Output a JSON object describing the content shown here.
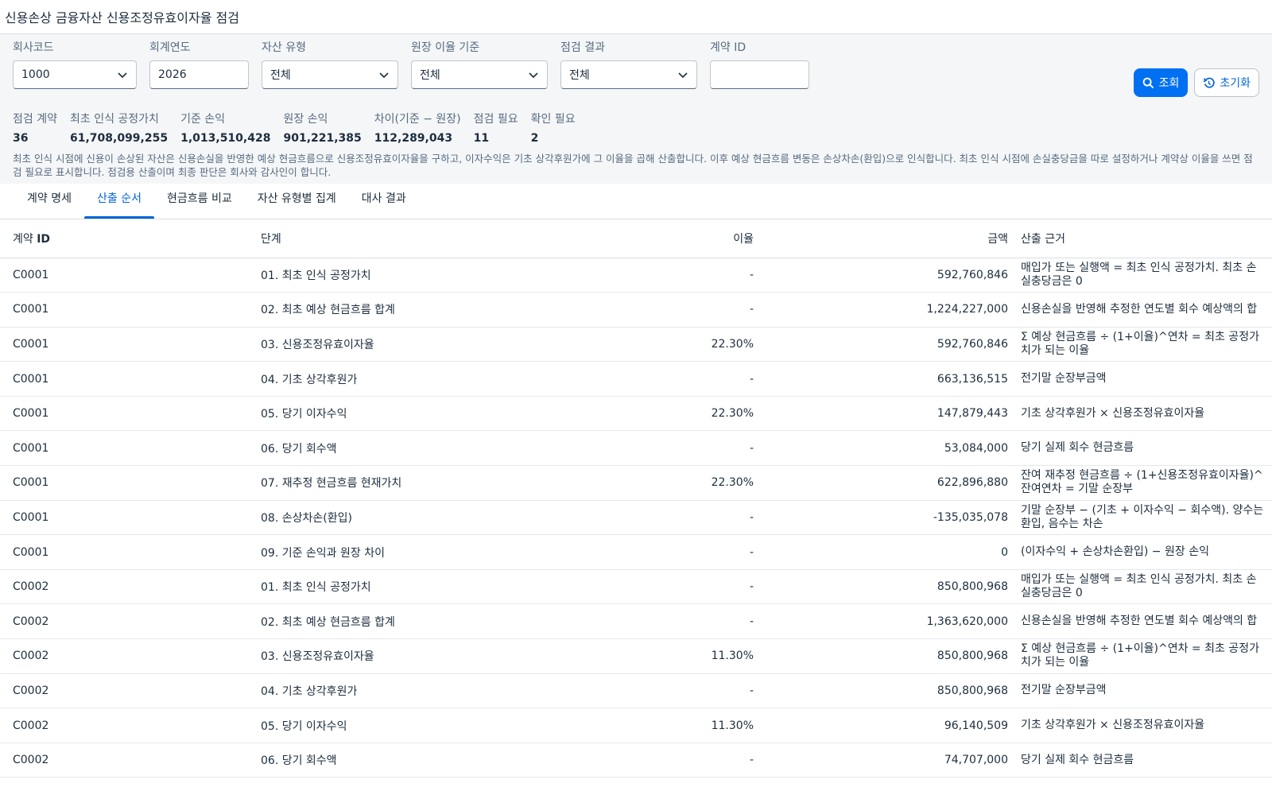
{
  "app": {
    "title": "신용손상 금융자산 신용조정유효이자율 점검"
  },
  "filters": {
    "company_code": {
      "label": "회사코드",
      "value": "1000"
    },
    "fiscal_year": {
      "label": "회계연도",
      "value": "2026"
    },
    "asset_type": {
      "label": "자산 유형",
      "value": "전체"
    },
    "ledger_rate_basis": {
      "label": "원장 이율 기준",
      "value": "전체"
    },
    "check_result": {
      "label": "점검 결과",
      "value": "전체"
    },
    "contract_id": {
      "label": "계약 ID",
      "value": "",
      "placeholder": ""
    }
  },
  "actions": {
    "search_label": "조회",
    "reset_label": "초기화"
  },
  "kpis": [
    {
      "label": "점검 계약",
      "value": "36"
    },
    {
      "label": "최초 인식 공정가치",
      "value": "61,708,099,255"
    },
    {
      "label": "기준 손익",
      "value": "1,013,510,428"
    },
    {
      "label": "원장 손익",
      "value": "901,221,385"
    },
    {
      "label": "차이(기준 − 원장)",
      "value": "112,289,043"
    },
    {
      "label": "점검 필요",
      "value": "11"
    },
    {
      "label": "확인 필요",
      "value": "2"
    }
  ],
  "note": "최초 인식 시점에 신용이 손상된 자산은 신용손실을 반영한 예상 현금흐름으로 신용조정유효이자율을 구하고, 이자수익은 기초 상각후원가에 그 이율을 곱해 산출합니다. 이후 예상 현금흐름 변동은 손상차손(환입)으로 인식합니다. 최초 인식 시점에 손실충당금을 따로 설정하거나 계약상 이율을 쓰면 점검 필요로 표시합니다. 점검용 산출이며 최종 판단은 회사와 감사인이 합니다.",
  "tabs": [
    {
      "label": "계약 명세",
      "active": false
    },
    {
      "label": "산출 순서",
      "active": true
    },
    {
      "label": "현금흐름 비교",
      "active": false
    },
    {
      "label": "자산 유형별 집계",
      "active": false
    },
    {
      "label": "대사 결과",
      "active": false
    }
  ],
  "table": {
    "headers": {
      "contract_id_prefix": "계약 ",
      "contract_id_suffix": "ID",
      "step": "단계",
      "rate": "이율",
      "amount": "금액",
      "basis": "산출 근거"
    },
    "rows": [
      {
        "id": "C0001",
        "step": "01. 최초 인식 공정가치",
        "rate": "-",
        "amount": "592,760,846",
        "basis": "매입가 또는 실행액 = 최초 인식 공정가치. 최초 손실충당금은 0"
      },
      {
        "id": "C0001",
        "step": "02. 최초 예상 현금흐름 합계",
        "rate": "-",
        "amount": "1,224,227,000",
        "basis": "신용손실을 반영해 추정한 연도별 회수 예상액의 합"
      },
      {
        "id": "C0001",
        "step": "03. 신용조정유효이자율",
        "rate": "22.30%",
        "amount": "592,760,846",
        "basis": "Σ 예상 현금흐름 ÷ (1+이율)^연차 = 최초 공정가치가 되는 이율"
      },
      {
        "id": "C0001",
        "step": "04. 기초 상각후원가",
        "rate": "-",
        "amount": "663,136,515",
        "basis": "전기말 순장부금액"
      },
      {
        "id": "C0001",
        "step": "05. 당기 이자수익",
        "rate": "22.30%",
        "amount": "147,879,443",
        "basis": "기초 상각후원가 × 신용조정유효이자율"
      },
      {
        "id": "C0001",
        "step": "06. 당기 회수액",
        "rate": "-",
        "amount": "53,084,000",
        "basis": "당기 실제 회수 현금흐름"
      },
      {
        "id": "C0001",
        "step": "07. 재추정 현금흐름 현재가치",
        "rate": "22.30%",
        "amount": "622,896,880",
        "basis": "잔여 재추정 현금흐름 ÷ (1+신용조정유효이자율)^잔여연차 = 기말 순장부"
      },
      {
        "id": "C0001",
        "step": "08. 손상차손(환입)",
        "rate": "-",
        "amount": "-135,035,078",
        "basis": "기말 순장부 − (기초 + 이자수익 − 회수액). 양수는 환입, 음수는 차손"
      },
      {
        "id": "C0001",
        "step": "09. 기준 손익과 원장 차이",
        "rate": "-",
        "amount": "0",
        "basis": "(이자수익 + 손상차손환입) − 원장 손익"
      },
      {
        "id": "C0002",
        "step": "01. 최초 인식 공정가치",
        "rate": "-",
        "amount": "850,800,968",
        "basis": "매입가 또는 실행액 = 최초 인식 공정가치. 최초 손실충당금은 0"
      },
      {
        "id": "C0002",
        "step": "02. 최초 예상 현금흐름 합계",
        "rate": "-",
        "amount": "1,363,620,000",
        "basis": "신용손실을 반영해 추정한 연도별 회수 예상액의 합"
      },
      {
        "id": "C0002",
        "step": "03. 신용조정유효이자율",
        "rate": "11.30%",
        "amount": "850,800,968",
        "basis": "Σ 예상 현금흐름 ÷ (1+이율)^연차 = 최초 공정가치가 되는 이율"
      },
      {
        "id": "C0002",
        "step": "04. 기초 상각후원가",
        "rate": "-",
        "amount": "850,800,968",
        "basis": "전기말 순장부금액"
      },
      {
        "id": "C0002",
        "step": "05. 당기 이자수익",
        "rate": "11.30%",
        "amount": "96,140,509",
        "basis": "기초 상각후원가 × 신용조정유효이자율"
      },
      {
        "id": "C0002",
        "step": "06. 당기 회수액",
        "rate": "-",
        "amount": "74,707,000",
        "basis": "당기 실제 회수 현금흐름"
      }
    ]
  }
}
